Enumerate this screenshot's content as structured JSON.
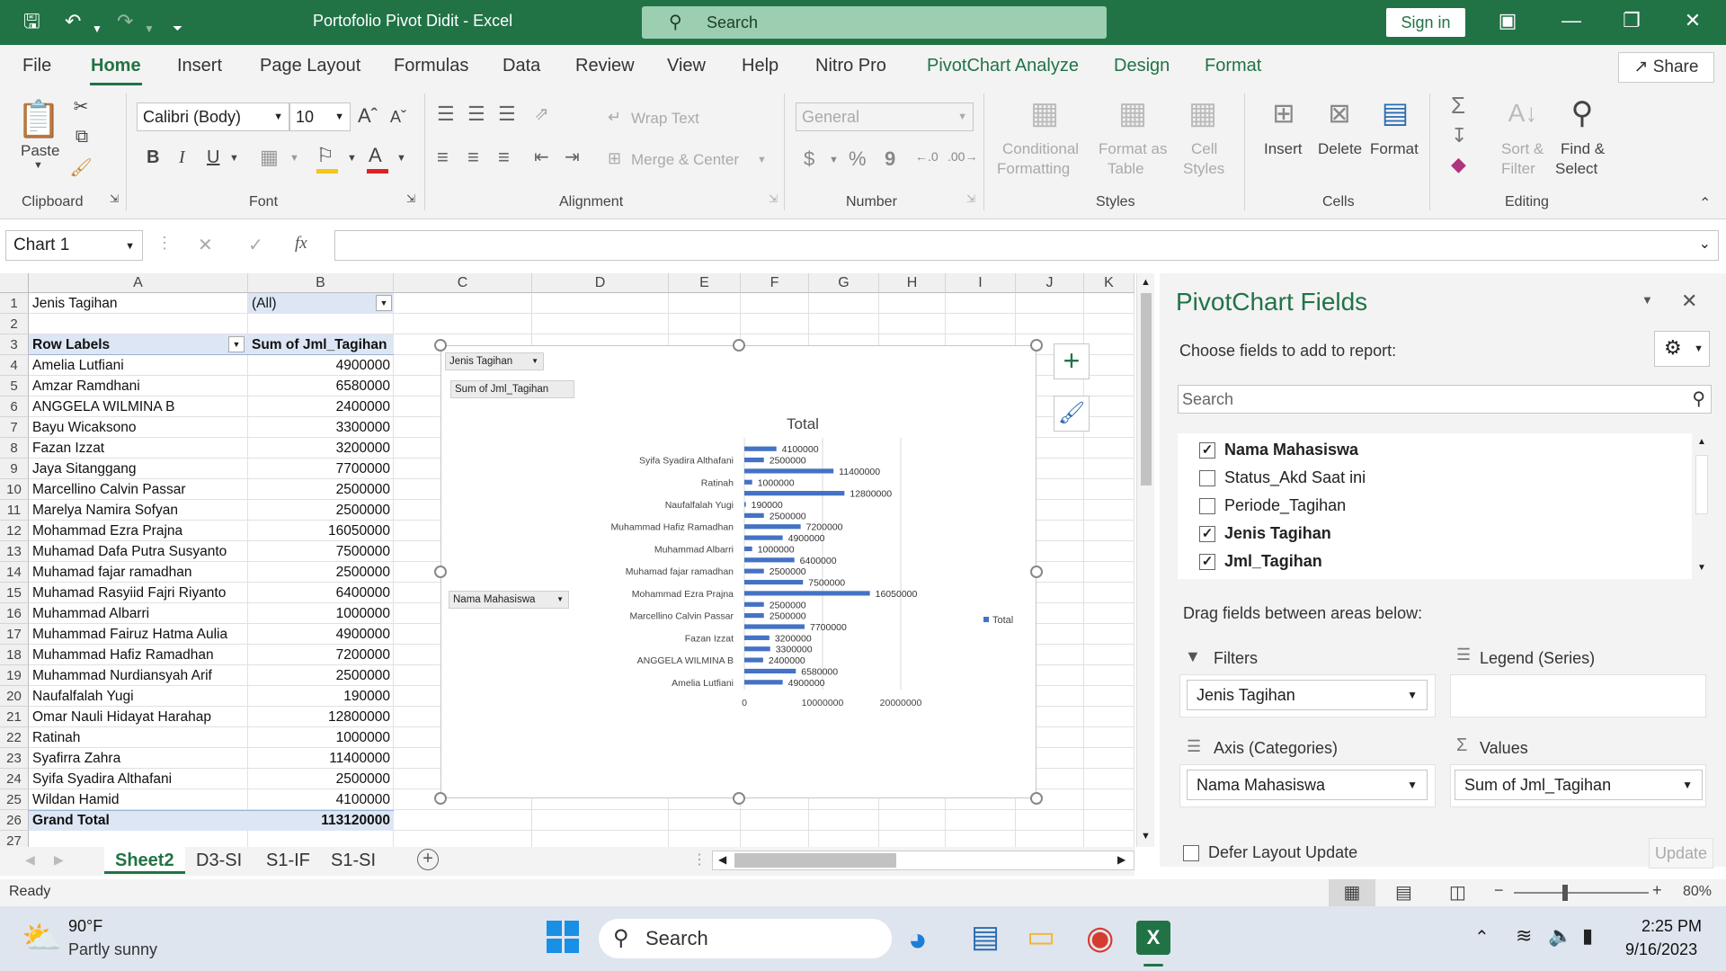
{
  "titlebar": {
    "doc_title": "Portofolio Pivot Didit  -  Excel",
    "search_placeholder": "Search",
    "signin": "Sign in"
  },
  "menu": [
    "File",
    "Home",
    "Insert",
    "Page Layout",
    "Formulas",
    "Data",
    "Review",
    "View",
    "Help",
    "Nitro Pro",
    "PivotChart Analyze",
    "Design",
    "Format"
  ],
  "share": "Share",
  "ribbon": {
    "clipboard": {
      "paste": "Paste",
      "label": "Clipboard"
    },
    "font": {
      "name": "Calibri (Body)",
      "size": "10",
      "bold": "B",
      "italic": "I",
      "underline": "U",
      "label": "Font"
    },
    "alignment": {
      "wrap": "Wrap Text",
      "merge": "Merge & Center",
      "label": "Alignment"
    },
    "number": {
      "format": "General",
      "currency": "$",
      "percent": "%",
      "comma": "9",
      "label": "Number"
    },
    "styles": {
      "cond1": "Conditional",
      "cond2": "Formatting",
      "fmt1": "Format as",
      "fmt2": "Table",
      "cell1": "Cell",
      "cell2": "Styles",
      "label": "Styles"
    },
    "cells": {
      "insert": "Insert",
      "delete": "Delete",
      "format": "Format",
      "label": "Cells"
    },
    "editing": {
      "sort1": "Sort &",
      "sort2": "Filter",
      "find1": "Find &",
      "find2": "Select",
      "label": "Editing"
    }
  },
  "formula_bar": {
    "name_box": "Chart 1",
    "fx": "fx",
    "value": ""
  },
  "columns": [
    "A",
    "B",
    "C",
    "D",
    "E",
    "F",
    "G",
    "H",
    "I",
    "J",
    "K"
  ],
  "sheet": {
    "filter_label": "Jenis Tagihan",
    "filter_value": "(All)",
    "header_row_labels": "Row Labels",
    "header_sum": "Sum of Jml_Tagihan",
    "rows": [
      {
        "name": "Amelia Lutfiani",
        "value": "4900000"
      },
      {
        "name": "Amzar Ramdhani",
        "value": "6580000"
      },
      {
        "name": "ANGGELA WILMINA B",
        "value": "2400000"
      },
      {
        "name": "Bayu Wicaksono",
        "value": "3300000"
      },
      {
        "name": "Fazan Izzat",
        "value": "3200000"
      },
      {
        "name": "Jaya Sitanggang",
        "value": "7700000"
      },
      {
        "name": "Marcellino Calvin Passar",
        "value": "2500000"
      },
      {
        "name": "Marelya Namira Sofyan",
        "value": "2500000"
      },
      {
        "name": "Mohammad Ezra Prajna",
        "value": "16050000"
      },
      {
        "name": "Muhamad Dafa Putra Susyanto",
        "value": "7500000"
      },
      {
        "name": "Muhamad fajar ramadhan",
        "value": "2500000"
      },
      {
        "name": "Muhamad Rasyiid Fajri Riyanto",
        "value": "6400000"
      },
      {
        "name": "Muhammad Albarri",
        "value": "1000000"
      },
      {
        "name": "Muhammad Fairuz Hatma Aulia",
        "value": "4900000"
      },
      {
        "name": "Muhammad Hafiz Ramadhan",
        "value": "7200000"
      },
      {
        "name": "Muhammad Nurdiansyah Arif",
        "value": "2500000"
      },
      {
        "name": "Naufalfalah Yugi",
        "value": "190000"
      },
      {
        "name": "Omar Nauli Hidayat Harahap",
        "value": "12800000"
      },
      {
        "name": "Ratinah",
        "value": "1000000"
      },
      {
        "name": "Syafirra Zahra",
        "value": "11400000"
      },
      {
        "name": "Syifa Syadira Althafani",
        "value": "2500000"
      },
      {
        "name": "Wildan Hamid",
        "value": "4100000"
      }
    ],
    "grand_total_label": "Grand Total",
    "grand_total_value": "113120000"
  },
  "chart_data": {
    "type": "bar",
    "orientation": "horizontal",
    "title": "Total",
    "filter_button": "Jenis Tagihan",
    "value_button": "Sum of Jml_Tagihan",
    "axis_button": "Nama Mahasiswa",
    "legend": "Total",
    "legend_position": "right",
    "color": "#4472c4",
    "categories": [
      "Amelia Lutfiani",
      "Amzar Ramdhani",
      "ANGGELA WILMINA B",
      "Bayu Wicaksono",
      "Fazan Izzat",
      "Jaya Sitanggang",
      "Marcellino Calvin Passar",
      "Marelya Namira Sofyan",
      "Mohammad Ezra Prajna",
      "Muhamad Dafa Putra Susyanto",
      "Muhamad fajar ramadhan",
      "Muhamad Rasyiid Fajri Riyanto",
      "Muhammad Albarri",
      "Muhammad Fairuz Hatma Aulia",
      "Muhammad Hafiz Ramadhan",
      "Muhammad Nurdiansyah Arif",
      "Naufalfalah Yugi",
      "Omar Nauli Hidayat Harahap",
      "Ratinah",
      "Syafirra Zahra",
      "Syifa Syadira Althafani",
      "Wildan Hamid"
    ],
    "values": [
      4900000,
      6580000,
      2400000,
      3300000,
      3200000,
      7700000,
      2500000,
      2500000,
      16050000,
      7500000,
      2500000,
      6400000,
      1000000,
      4900000,
      7200000,
      2500000,
      190000,
      12800000,
      1000000,
      11400000,
      2500000,
      4100000
    ],
    "shown_category_labels": [
      "Amelia Lutfiani",
      "ANGGELA WILMINA B",
      "Fazan Izzat",
      "Marcellino Calvin Passar",
      "Mohammad Ezra Prajna",
      "Muhamad fajar ramadhan",
      "Muhammad Albarri",
      "Muhammad Hafiz Ramadhan",
      "Naufalfalah Yugi",
      "Ratinah",
      "Syifa Syadira Althafani"
    ],
    "x_ticks": [
      "0",
      "10000000",
      "20000000"
    ],
    "xlim": [
      0,
      20000000
    ]
  },
  "pane": {
    "title": "PivotChart Fields",
    "choose": "Choose fields to add to report:",
    "search_placeholder": "Search",
    "fields": [
      {
        "name": "Nama Mahasiswa",
        "checked": true
      },
      {
        "name": "Status_Akd Saat ini",
        "checked": false
      },
      {
        "name": "Periode_Tagihan",
        "checked": false
      },
      {
        "name": "Jenis Tagihan",
        "checked": true
      },
      {
        "name": "Jml_Tagihan",
        "checked": true
      }
    ],
    "drag": "Drag fields between areas below:",
    "filters_title": "Filters",
    "filters_value": "Jenis Tagihan",
    "legend_title": "Legend (Series)",
    "axis_title": "Axis (Categories)",
    "axis_value": "Nama Mahasiswa",
    "values_title": "Values",
    "values_value": "Sum of Jml_Tagihan",
    "defer": "Defer Layout Update",
    "update": "Update"
  },
  "sheet_tabs": [
    "Sheet2",
    "D3-SI",
    "S1-IF",
    "S1-SI"
  ],
  "status": {
    "ready": "Ready",
    "zoom": "80%"
  },
  "taskbar": {
    "temp": "90°F",
    "weather": "Partly sunny",
    "search": "Search",
    "time": "2:25 PM",
    "date": "9/16/2023"
  }
}
